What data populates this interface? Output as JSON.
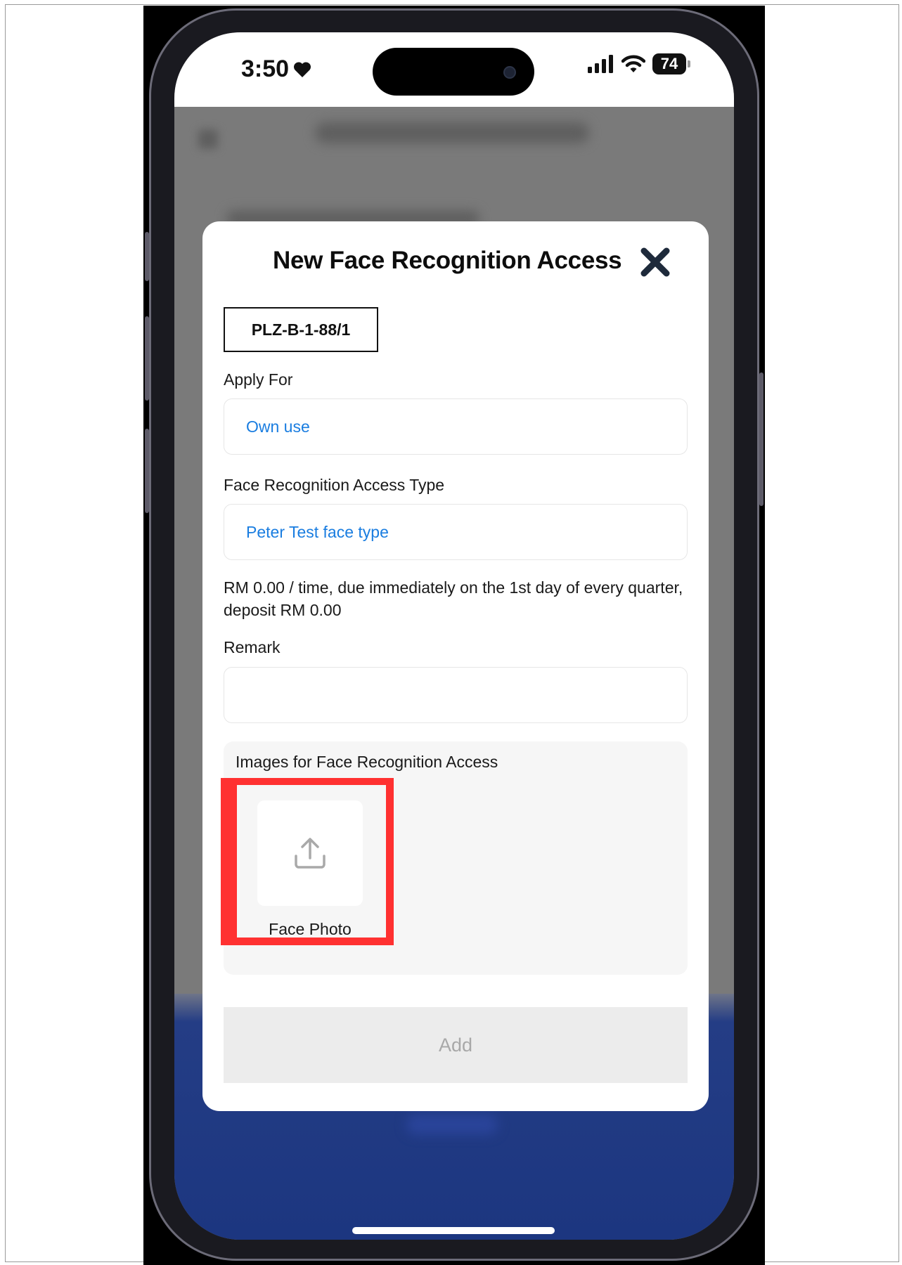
{
  "status_bar": {
    "time": "3:50",
    "battery": "74"
  },
  "modal": {
    "title": "New Face Recognition Access",
    "unit": "PLZ-B-1-88/1",
    "apply_for": {
      "label": "Apply For",
      "value": "Own use"
    },
    "access_type": {
      "label": "Face Recognition Access Type",
      "value": "Peter Test face type"
    },
    "fee_description": "RM 0.00 / time, due immediately on the 1st day of every quarter, deposit RM 0.00",
    "remark": {
      "label": "Remark",
      "value": ""
    },
    "images": {
      "label": "Images for Face Recognition Access",
      "face_photo_label": "Face Photo"
    },
    "add_label": "Add"
  },
  "colors": {
    "link_blue": "#1a7de0",
    "highlight_red": "#ff3131",
    "nav_blue": "#1c3680"
  }
}
